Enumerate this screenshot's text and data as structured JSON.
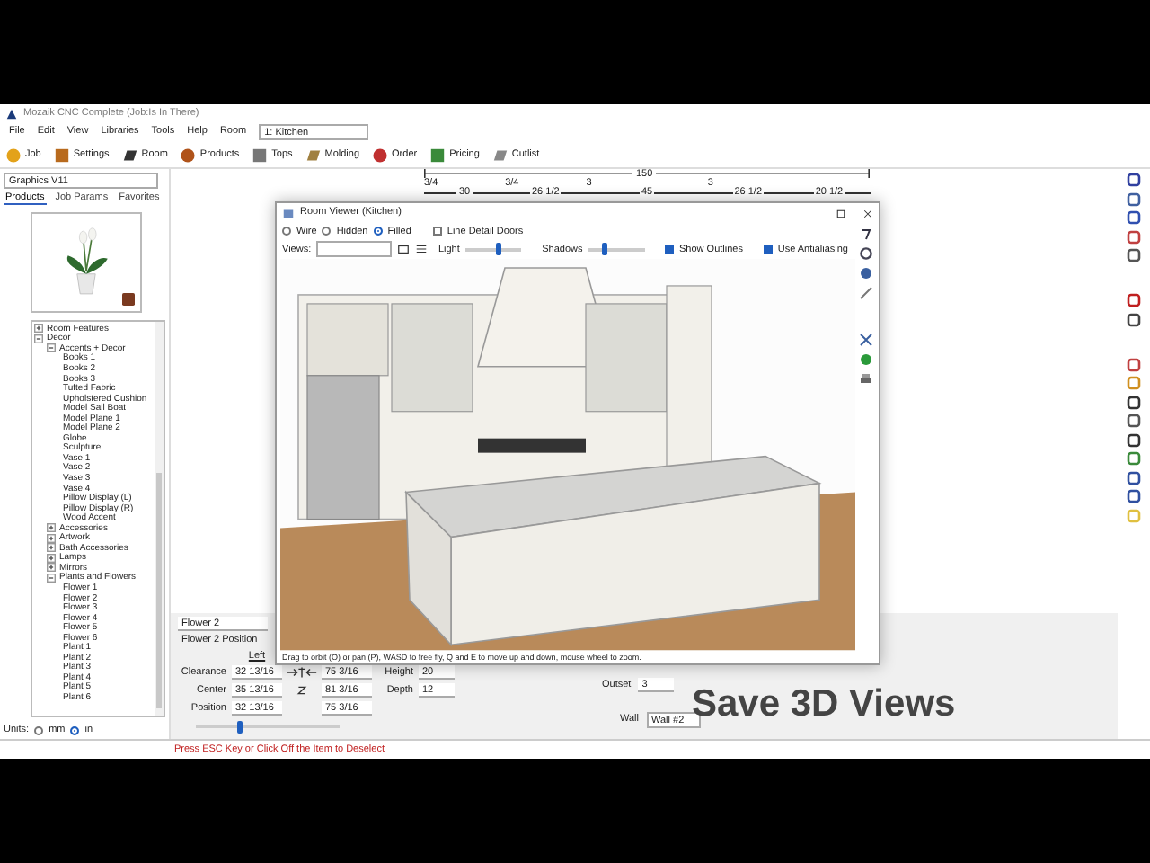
{
  "window": {
    "title": "Mozaik CNC Complete (Job:Is In There)"
  },
  "menu": [
    "File",
    "Edit",
    "View",
    "Libraries",
    "Tools",
    "Help"
  ],
  "room_select": {
    "label": "Room",
    "value": "1: Kitchen"
  },
  "toolbar": [
    {
      "label": "Job"
    },
    {
      "label": "Settings"
    },
    {
      "label": "Room"
    },
    {
      "label": "Products"
    },
    {
      "label": "Tops"
    },
    {
      "label": "Molding"
    },
    {
      "label": "Order"
    },
    {
      "label": "Pricing"
    },
    {
      "label": "Cutlist"
    }
  ],
  "graphics_select": {
    "value": "Graphics V11"
  },
  "library_tabs": [
    {
      "label": "Products",
      "selected": true
    },
    {
      "label": "Job Params",
      "selected": false
    },
    {
      "label": "Favorites",
      "selected": false
    }
  ],
  "tree": [
    {
      "label": "Room Features",
      "expanded": false
    },
    {
      "label": "Decor",
      "expanded": true,
      "children": [
        {
          "label": "Accents + Decor",
          "expanded": true,
          "children": [
            {
              "label": "Books 1"
            },
            {
              "label": "Books 2"
            },
            {
              "label": "Books 3"
            },
            {
              "label": "Tufted Fabric"
            },
            {
              "label": "Upholstered Cushion"
            },
            {
              "label": "Model Sail Boat"
            },
            {
              "label": "Model Plane 1"
            },
            {
              "label": "Model Plane 2"
            },
            {
              "label": "Globe"
            },
            {
              "label": "Sculpture"
            },
            {
              "label": "Vase 1"
            },
            {
              "label": "Vase 2"
            },
            {
              "label": "Vase 3"
            },
            {
              "label": "Vase 4"
            },
            {
              "label": "Pillow Display (L)"
            },
            {
              "label": "Pillow Display (R)"
            },
            {
              "label": "Wood Accent"
            }
          ]
        },
        {
          "label": "Accessories",
          "expanded": false
        },
        {
          "label": "Artwork",
          "expanded": false
        },
        {
          "label": "Bath Accessories",
          "expanded": false
        },
        {
          "label": "Lamps",
          "expanded": false
        },
        {
          "label": "Mirrors",
          "expanded": false
        },
        {
          "label": "Plants and Flowers",
          "expanded": true,
          "children": [
            {
              "label": "Flower 1"
            },
            {
              "label": "Flower 2"
            },
            {
              "label": "Flower 3"
            },
            {
              "label": "Flower 4"
            },
            {
              "label": "Flower 5"
            },
            {
              "label": "Flower 6"
            },
            {
              "label": "Plant 1"
            },
            {
              "label": "Plant 2"
            },
            {
              "label": "Plant 3"
            },
            {
              "label": "Plant 4"
            },
            {
              "label": "Plant 5"
            },
            {
              "label": "Plant 6"
            }
          ]
        }
      ]
    }
  ],
  "units": {
    "label": "Units:",
    "options": [
      {
        "label": "mm",
        "selected": false
      },
      {
        "label": "in",
        "selected": true
      }
    ]
  },
  "ruler": {
    "overall": "150",
    "segments": [
      {
        "label": "30",
        "mark": "3/4"
      },
      {
        "label": "26 1/2",
        "mark": "3/4"
      },
      {
        "label": "45",
        "mark": "3"
      },
      {
        "label": "26 1/2",
        "mark": "3"
      },
      {
        "label": "20 1/2"
      }
    ]
  },
  "room_viewer": {
    "title": "Room Viewer (Kitchen)",
    "render_modes": [
      {
        "label": "Wire",
        "selected": false
      },
      {
        "label": "Hidden",
        "selected": false
      },
      {
        "label": "Filled",
        "selected": true
      }
    ],
    "line_detail_doors": {
      "label": "Line Detail Doors",
      "checked": false
    },
    "views_label": "Views:",
    "light": {
      "label": "Light",
      "level": 0.6
    },
    "shadows": {
      "label": "Shadows",
      "level": 0.3
    },
    "show_outlines": {
      "label": "Show Outlines",
      "checked": true
    },
    "antialiasing": {
      "label": "Use Antialiasing",
      "checked": true
    },
    "hint": "Drag to orbit (O) or pan (P), WASD to free fly, Q and E to move up and down, mouse wheel to zoom."
  },
  "properties": {
    "item_name": "Flower 2",
    "section": "Flower 2 Position",
    "column_header": "Left",
    "rows": [
      {
        "label": "Clearance",
        "left": "32 13/16",
        "right": "75 3/16"
      },
      {
        "label": "Center",
        "left": "35 13/16",
        "right": "81 3/16"
      },
      {
        "label": "Position",
        "left": "32 13/16",
        "right": "75 3/16"
      }
    ],
    "dims": [
      {
        "label": "Height",
        "value": "20"
      },
      {
        "label": "Depth",
        "value": "12"
      }
    ],
    "outset": {
      "label": "Outset",
      "value": "3"
    },
    "wall": {
      "label": "Wall",
      "value": "Wall #2"
    },
    "slider": {
      "level": 0.3
    }
  },
  "status_message": "Press ESC Key or Click Off the Item to Deselect",
  "caption": "Save 3D Views"
}
